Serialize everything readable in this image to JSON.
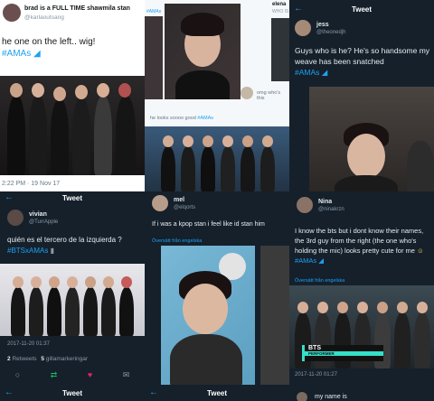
{
  "p1": {
    "user_name": "brad is a FULL TIME shawmila stan",
    "user_handle": "@karlaoutsang",
    "text": "he one on the left.. wig!",
    "hashtag": "#AMAs",
    "timestamp": "2:22 PM · 19 Nov 17"
  },
  "p2": {
    "user_name": "elena",
    "user_handle": "WHO IS",
    "hashtag_small": "#AMAs",
    "reply_preview": "omg who's this",
    "caption": "he looks soooo good",
    "caption_tag": "#AMAs"
  },
  "p3": {
    "header_title": "Tweet",
    "user_name": "jess",
    "user_handle": "@theonedjh",
    "text": "Guys who is he? He's so handsome my weave has been snatched",
    "hashtag": "#AMAs"
  },
  "p4": {
    "header_title": "Tweet",
    "user_name": "vivian",
    "user_handle": "@TurrApple",
    "text": "quién es el tercero de la izquierda ?",
    "hashtag": "#BTSxAMAs",
    "timestamp": "2017-11-20 01:37",
    "retweets_count": "2",
    "retweets_label": "Retweets",
    "likes_count": "5",
    "likes_label": "gillamarkeringar",
    "footer_title": "Tweet"
  },
  "p5": {
    "user_name": "mel",
    "user_handle": "@elqorts",
    "text": "If i was a kpop stan i feel like id stan him",
    "translate": "Översätt från engelska",
    "footer_title": "Tweet"
  },
  "p6": {
    "user_name": "Nina",
    "user_handle": "@ninakrzn",
    "text": "I know the bts but i dont know their names, the 3rd guy from the right (the one who's holding the mic) looks pretty cute for me",
    "hashtag": "#AMAs",
    "translate": "Översätt från engelska",
    "banner_title": "BTS",
    "banner_sub": "PERFORMER",
    "timestamp": "2017-11-20 01:27",
    "footer_preview": "my name is"
  }
}
